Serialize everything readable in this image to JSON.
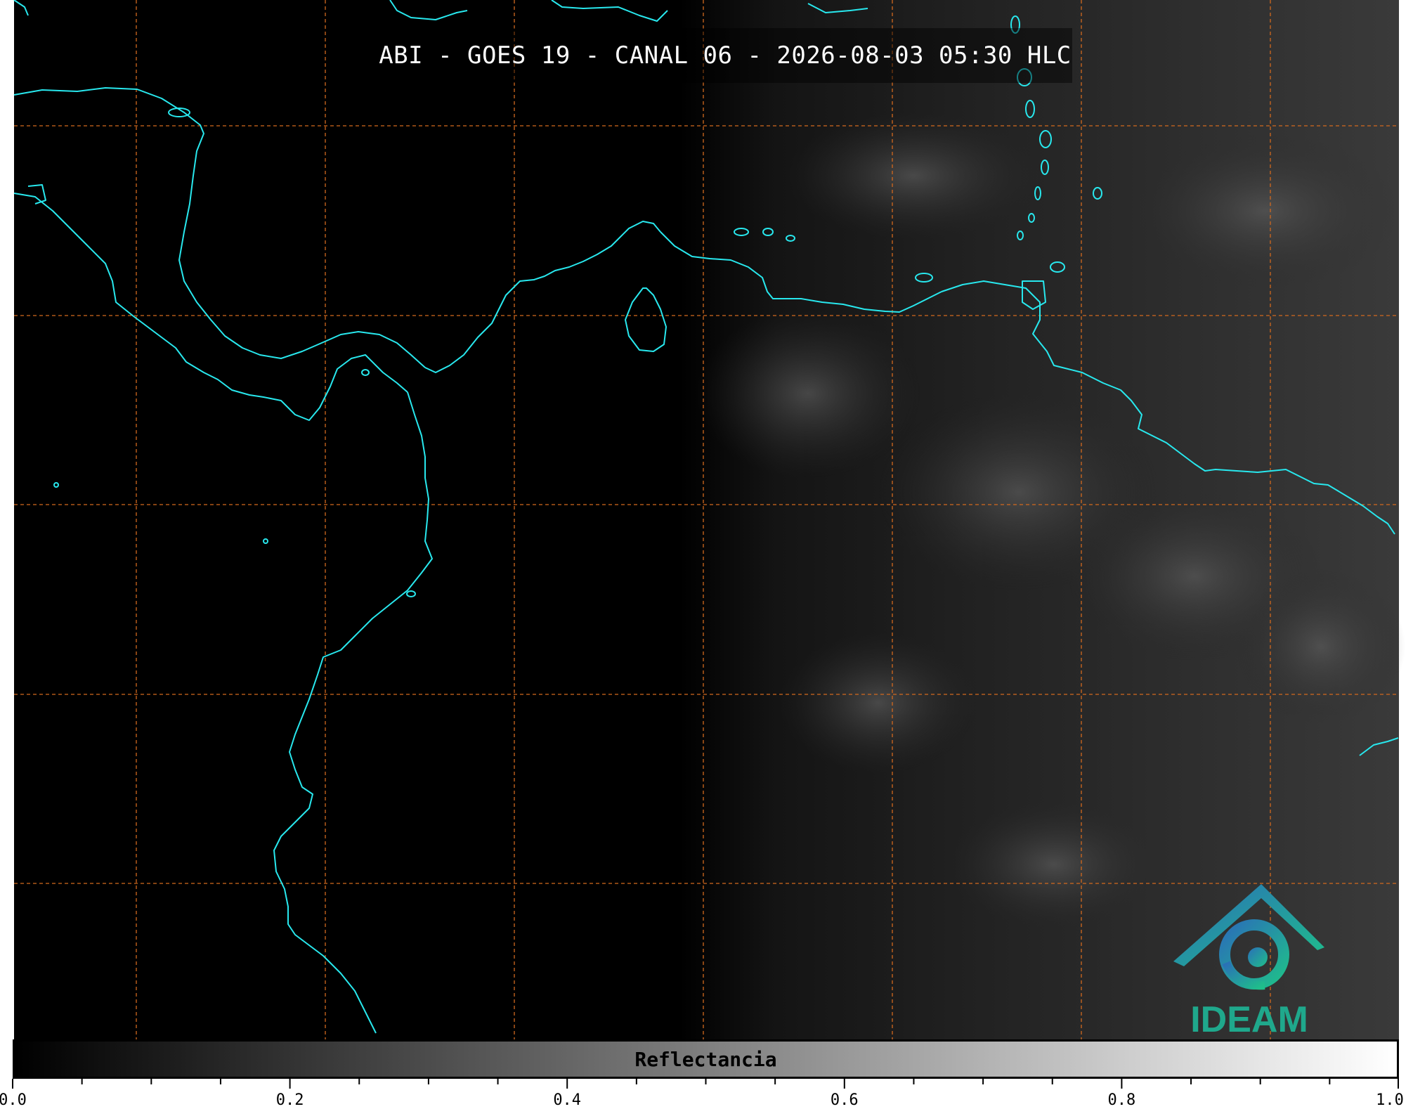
{
  "map": {
    "title": "ABI - GOES 19 - CANAL 06 - 2026-08-03 05:30 HLC",
    "colors": {
      "background": "#000000",
      "coastline": "#28e8ee",
      "gridline": "#d2691e",
      "logo_teal": "#1fa88c",
      "logo_blue": "#2a6fb8"
    },
    "logo": {
      "text": "IDEAM"
    }
  },
  "colorbar": {
    "label": "Reflectancia",
    "range": [
      0.0,
      1.0
    ],
    "tick_labels": [
      "0.0",
      "0.2",
      "0.4",
      "0.6",
      "0.8",
      "1.0"
    ],
    "colormap": "grayscale"
  }
}
